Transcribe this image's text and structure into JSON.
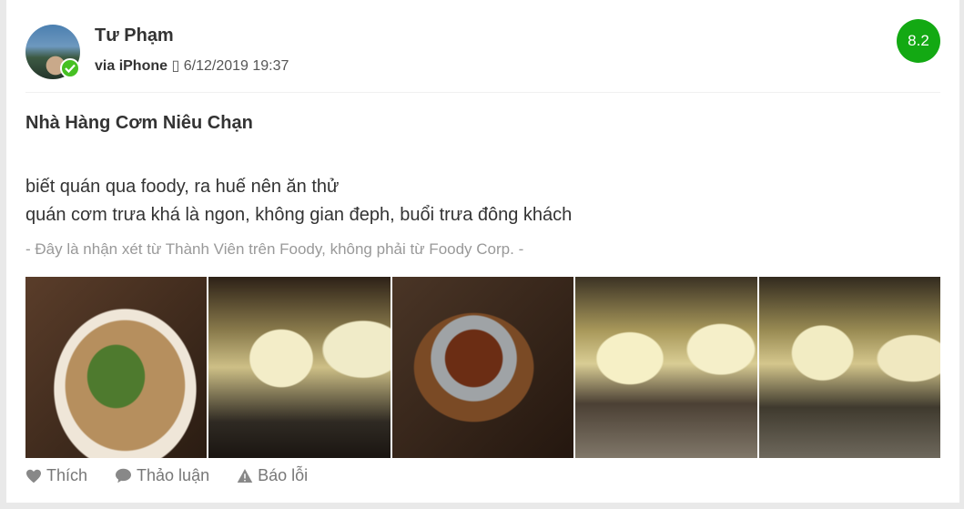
{
  "review": {
    "author": {
      "name": "Tư Phạm",
      "avatar_icon": "user-avatar",
      "verified_icon": "check-badge-icon"
    },
    "via_label": "via iPhone",
    "device_glyph": "▯",
    "timestamp": "6/12/2019 19:37",
    "score": "8.2",
    "score_color": "#13a913",
    "restaurant_title": "Nhà Hàng Cơm Niêu Chạn",
    "body_lines": [
      "biết quán qua foody, ra huế nên ăn thử",
      "quán cơm trưa khá là ngon, không gian đeph, buổi trưa đông khách"
    ],
    "disclaimer": "- Đây là nhận xét từ Thành Viên trên Foody, không phải từ Foody Corp. -",
    "photos": [
      "food-salad-photo",
      "restaurant-interior-photo",
      "clay-pot-dish-photo",
      "dining-room-photo",
      "dining-room-photo"
    ],
    "actions": {
      "like": "Thích",
      "discuss": "Thảo luận",
      "report": "Báo lỗi"
    }
  }
}
